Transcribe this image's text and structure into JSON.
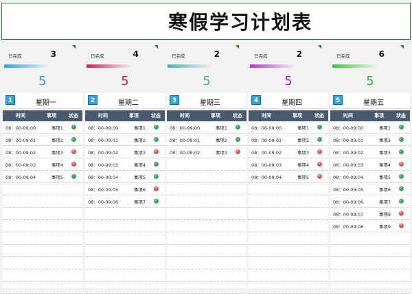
{
  "title": "寒假学习计划表",
  "stat_label": "已完成",
  "days": [
    {
      "badge": "1",
      "day": "星期一",
      "done": "3",
      "total": "5",
      "total_color": "#2a9fd6",
      "bar_color": "#29a8e0",
      "header": {
        "time": "时间",
        "item": "事项",
        "status": "状态"
      },
      "rows": [
        {
          "time": "08：00-09:00",
          "item": "事项1",
          "status": "done"
        },
        {
          "time": "08：00-09:01",
          "item": "事项2",
          "status": "done"
        },
        {
          "time": "08：00-09:02",
          "item": "事项3",
          "status": "todo"
        },
        {
          "time": "08：00-09:03",
          "item": "事项4",
          "status": "todo"
        },
        {
          "time": "08：00-09:04",
          "item": "事项5",
          "status": "done"
        }
      ]
    },
    {
      "badge": "2",
      "day": "星期二",
      "done": "4",
      "total": "5",
      "total_color": "#c2185b",
      "bar_color": "#d81b60",
      "header": {
        "time": "时间",
        "item": "事项",
        "status": "状态"
      },
      "rows": [
        {
          "time": "08：00-09:00",
          "item": "事项1",
          "status": "done"
        },
        {
          "time": "08：00-09:01",
          "item": "事项2",
          "status": "done"
        },
        {
          "time": "08：00-09:02",
          "item": "事项3",
          "status": "todo"
        },
        {
          "time": "08：00-09:03",
          "item": "事项4",
          "status": "done"
        },
        {
          "time": "08：00-09:04",
          "item": "事项5",
          "status": "done"
        },
        {
          "time": "08：00-09:05",
          "item": "事项6",
          "status": "todo"
        },
        {
          "time": "08：00-09:06",
          "item": "事项7",
          "status": "done"
        }
      ]
    },
    {
      "badge": "3",
      "day": "星期三",
      "done": "2",
      "total": "5",
      "total_color": "#4caf8a",
      "bar_color": "#4db6ac",
      "header": {
        "time": "时间",
        "item": "事项",
        "status": "状态"
      },
      "rows": [
        {
          "time": "08：00-09:00",
          "item": "事项1",
          "status": "done"
        },
        {
          "time": "08：00-09:01",
          "item": "事项2",
          "status": "done"
        },
        {
          "time": "08：00-09:02",
          "item": "事项3",
          "status": "todo"
        }
      ]
    },
    {
      "badge": "4",
      "day": "星期四",
      "done": "2",
      "total": "5",
      "total_color": "#9c27b0",
      "bar_color": "#ba33d6",
      "header": {
        "time": "时间",
        "item": "事项",
        "status": "状态"
      },
      "rows": [
        {
          "time": "08：00-09:00",
          "item": "事项1",
          "status": "done"
        },
        {
          "time": "08：00-09:01",
          "item": "事项2",
          "status": "done"
        },
        {
          "time": "08：00-09:02",
          "item": "事项3",
          "status": "todo"
        },
        {
          "time": "08：00-09:03",
          "item": "事项4",
          "status": "todo"
        },
        {
          "time": "08：00-09:04",
          "item": "事项5",
          "status": "todo"
        }
      ]
    },
    {
      "badge": "5",
      "day": "星期五",
      "done": "6",
      "total": "5",
      "total_color": "#2db52d",
      "bar_color": "#33cc33",
      "header": {
        "time": "时间",
        "item": "事项",
        "status": "状态"
      },
      "rows": [
        {
          "time": "08：00-09:00",
          "item": "事项1",
          "status": "done"
        },
        {
          "time": "08：00-09:01",
          "item": "事项2",
          "status": "done"
        },
        {
          "time": "08：00-09:02",
          "item": "事项3",
          "status": "done"
        },
        {
          "time": "08：00-09:03",
          "item": "事项4",
          "status": "todo"
        },
        {
          "time": "08：00-09:04",
          "item": "事项5",
          "status": "done"
        },
        {
          "time": "08：00-09:05",
          "item": "事项6",
          "status": "done"
        },
        {
          "time": "08：00-09:06",
          "item": "事项7",
          "status": "done"
        },
        {
          "time": "08：00-09:07",
          "item": "事项8",
          "status": "todo"
        },
        {
          "time": "08：00-09:08",
          "item": "事项9",
          "status": "todo"
        }
      ]
    }
  ]
}
